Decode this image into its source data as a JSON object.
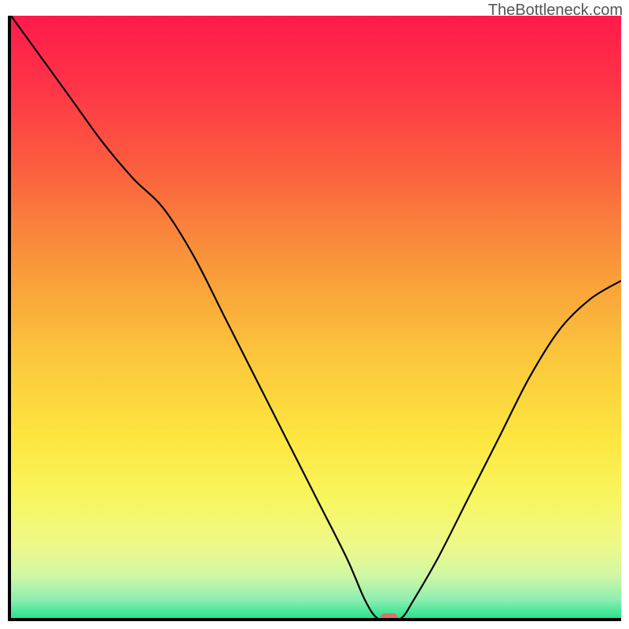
{
  "watermark": "TheBottleneck.com",
  "chart_data": {
    "type": "line",
    "title": "",
    "xlabel": "",
    "ylabel": "",
    "xlim": [
      0,
      100
    ],
    "ylim": [
      0,
      100
    ],
    "x": [
      0,
      5,
      10,
      15,
      20,
      25,
      30,
      35,
      40,
      45,
      50,
      55,
      58,
      60,
      62,
      64,
      66,
      70,
      75,
      80,
      85,
      90,
      95,
      100
    ],
    "values": [
      100,
      93,
      86,
      79,
      73,
      68,
      60,
      50,
      40,
      30,
      20,
      10,
      3,
      0,
      0,
      0,
      3,
      10,
      20,
      30,
      40,
      48,
      53,
      56
    ],
    "marker": {
      "x": 62,
      "y": 0
    },
    "background_gradient": {
      "stops": [
        {
          "pos": 0.0,
          "color": "#ff1a4a"
        },
        {
          "pos": 0.12,
          "color": "#ff3547"
        },
        {
          "pos": 0.25,
          "color": "#fb5e3f"
        },
        {
          "pos": 0.4,
          "color": "#f9933a"
        },
        {
          "pos": 0.55,
          "color": "#fbc23b"
        },
        {
          "pos": 0.7,
          "color": "#fde63f"
        },
        {
          "pos": 0.8,
          "color": "#f8f65e"
        },
        {
          "pos": 0.88,
          "color": "#eef98a"
        },
        {
          "pos": 0.93,
          "color": "#d0f7a4"
        },
        {
          "pos": 0.97,
          "color": "#8ceeb0"
        },
        {
          "pos": 1.0,
          "color": "#27e28f"
        }
      ]
    }
  }
}
